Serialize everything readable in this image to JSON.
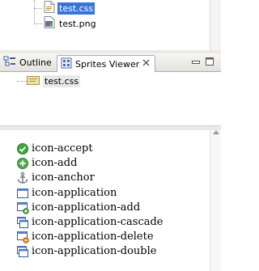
{
  "project_tree": {
    "items": [
      {
        "label": "test.css",
        "icon": "css-file-icon",
        "selected": true
      },
      {
        "label": "test.png",
        "icon": "png-file-icon",
        "selected": false
      }
    ]
  },
  "tabs": [
    {
      "label": "Outline",
      "icon": "outline-icon",
      "active": false
    },
    {
      "label": "Sprites Viewer",
      "icon": "sprites-viewer-icon",
      "active": true
    }
  ],
  "viewer_tree": {
    "file_label": "test.css",
    "icon": "stylesheet-folder-icon"
  },
  "icons_list": [
    {
      "label": "icon-accept",
      "icon": "accept-icon"
    },
    {
      "label": "icon-add",
      "icon": "add-icon"
    },
    {
      "label": "icon-anchor",
      "icon": "anchor-icon"
    },
    {
      "label": "icon-application",
      "icon": "application-icon"
    },
    {
      "label": "icon-application-add",
      "icon": "application-add-icon"
    },
    {
      "label": "icon-application-cascade",
      "icon": "application-cascade-icon"
    },
    {
      "label": "icon-application-delete",
      "icon": "application-delete-icon"
    },
    {
      "label": "icon-application-double",
      "icon": "application-double-icon"
    }
  ],
  "colors": {
    "selection": "#3875d7",
    "accept": "#3fa63f",
    "add": "#4cae4c",
    "delete": "#e58a1e",
    "window": "#2f5a9e"
  }
}
